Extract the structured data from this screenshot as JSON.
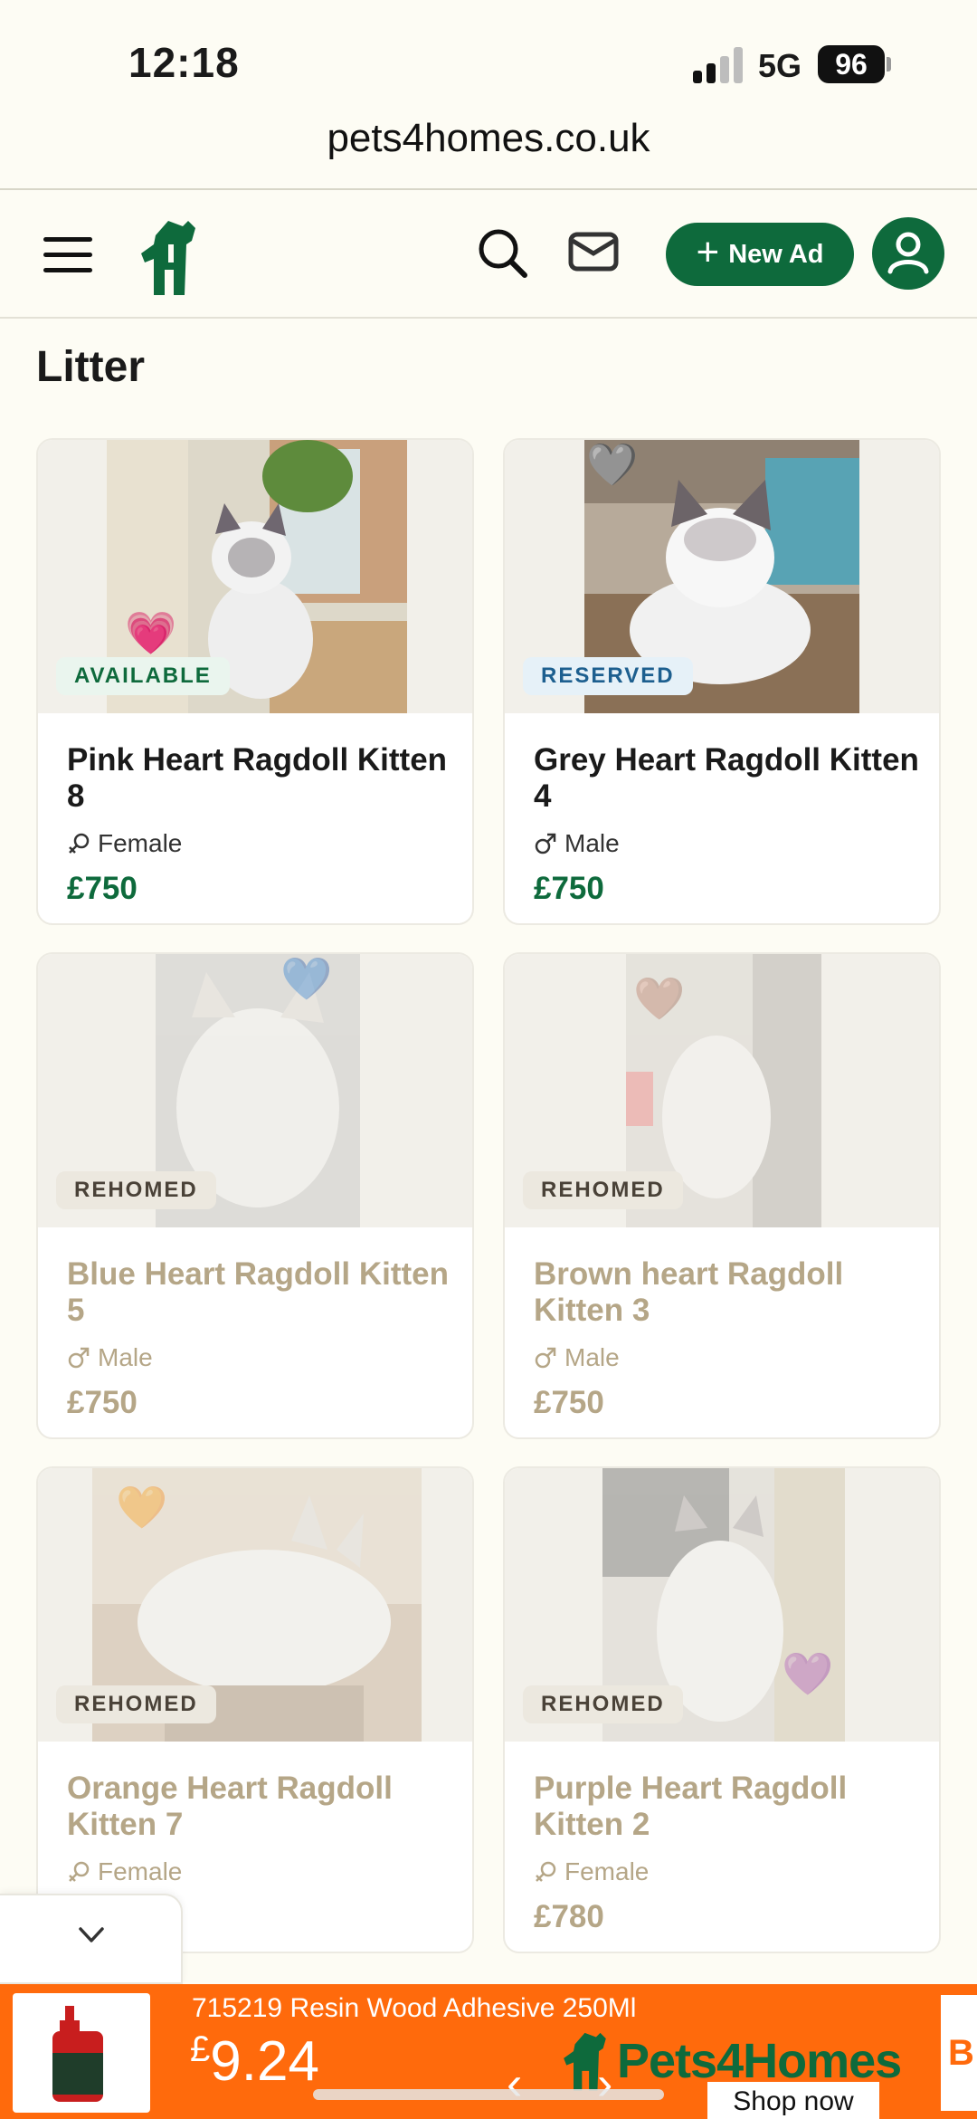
{
  "status_bar": {
    "time": "12:18",
    "network": "5G",
    "battery": "96"
  },
  "browser": {
    "url": "pets4homes.co.uk"
  },
  "header": {
    "new_ad_label": "New Ad"
  },
  "section": {
    "title": "Litter"
  },
  "listings": [
    {
      "title": "Pink Heart Ragdoll Kitten 8",
      "status": "AVAILABLE",
      "gender": "Female",
      "price": "£750",
      "heart": "💗"
    },
    {
      "title": "Grey Heart Ragdoll Kitten 4",
      "status": "RESERVED",
      "gender": "Male",
      "price": "£750",
      "heart": "🩶"
    },
    {
      "title": "Blue Heart Ragdoll Kitten 5",
      "status": "REHOMED",
      "gender": "Male",
      "price": "£750",
      "heart": "💙"
    },
    {
      "title": "Brown heart Ragdoll Kitten 3",
      "status": "REHOMED",
      "gender": "Male",
      "price": "£750",
      "heart": "🤎"
    },
    {
      "title": "Orange Heart Ragdoll Kitten 7",
      "status": "REHOMED",
      "gender": "Female",
      "price": "",
      "heart": "🧡"
    },
    {
      "title": "Purple Heart Ragdoll Kitten 2",
      "status": "REHOMED",
      "gender": "Female",
      "price": "£780",
      "heart": "💜"
    }
  ],
  "ad": {
    "product": "715219 Resin Wood Adhesive 250Ml",
    "currency": "£",
    "price": "9.24",
    "brand": "Pets4Homes",
    "cta": "Shop now",
    "next_card_letter": "B"
  },
  "colors": {
    "brand_green": "#0e6a3c",
    "ad_orange": "#ff6a0c",
    "page_bg": "#fdfcf4"
  }
}
